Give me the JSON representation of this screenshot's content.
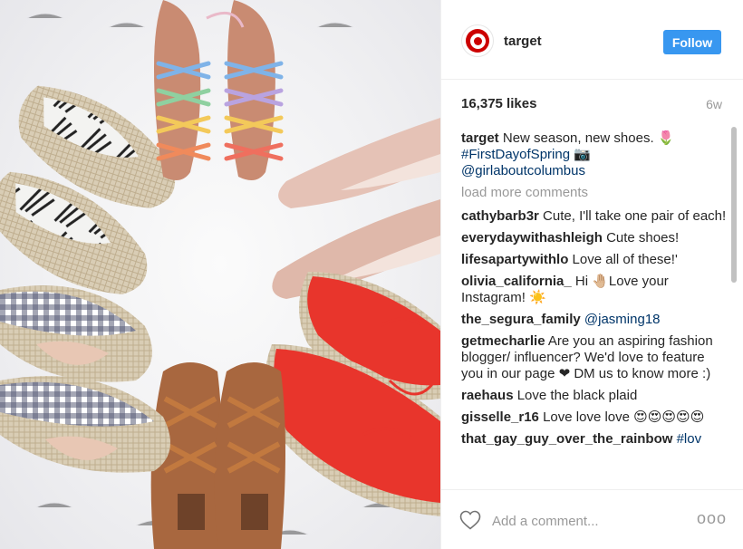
{
  "post": {
    "username": "target",
    "follow_label": "Follow",
    "likes": "16,375 likes",
    "time_ago": "6w",
    "caption": {
      "user": "target",
      "text": "New season, new shoes. 🌷",
      "hashtag": "#FirstDayofSpring",
      "hashtag_suffix": "📷",
      "mention": "@girlaboutcolumbus"
    },
    "load_more_label": "load more comments",
    "comments": [
      {
        "user": "cathybarb3r",
        "text": "Cute, I'll take one pair of each!"
      },
      {
        "user": "everydaywithashleigh",
        "text": "Cute shoes!"
      },
      {
        "user": "lifesapartywithlo",
        "text": "Love all of these!'"
      },
      {
        "user": "olivia_california_",
        "text": "Hi 🤚🏼Love your Instagram! ☀️"
      },
      {
        "user": "the_segura_family",
        "text": "@jasming18"
      },
      {
        "user": "getmecharlie",
        "text": "Are you an aspiring fashion blogger/ influencer? We'd love to feature you in our page ❤ DM us to know more :)"
      },
      {
        "user": "raehaus",
        "text": "Love the black plaid"
      },
      {
        "user": "gisselle_r16",
        "text": "Love love love 😍😍😍😍😍"
      },
      {
        "user": "that_gay_guy_over_the_rainbow",
        "text": "#lov"
      }
    ],
    "add_comment_placeholder": "Add a comment...",
    "more_options": "ooo"
  },
  "colors": {
    "follow_button": "#3897f0",
    "brand_red": "#cc0000",
    "link": "#003569",
    "muted": "#999999"
  },
  "icons": {
    "avatar": "target-logo-icon",
    "like": "heart-outline-icon",
    "options": "more-options-icon"
  }
}
